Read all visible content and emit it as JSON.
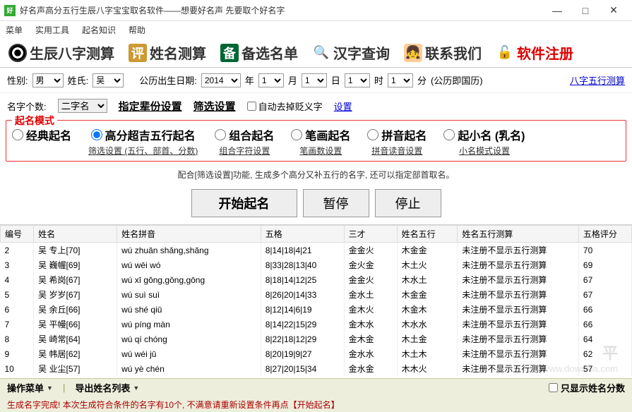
{
  "window": {
    "title": "好名声高分五行生辰八字宝宝取名软件——想要好名声 先要取个好名字",
    "minimize": "—",
    "maximize": "□",
    "close": "✕"
  },
  "menu": {
    "items": [
      "菜单",
      "实用工具",
      "起名知识",
      "帮助"
    ]
  },
  "tabs": [
    {
      "icon": "yinyang",
      "label": "生辰八字测算"
    },
    {
      "icon": "ping",
      "iconText": "评",
      "label": "姓名测算"
    },
    {
      "icon": "bei",
      "iconText": "备",
      "label": "备选名单"
    },
    {
      "icon": "mag",
      "iconText": "🔍",
      "label": "汉字查询"
    },
    {
      "icon": "face",
      "iconText": "👧",
      "label": "联系我们"
    },
    {
      "icon": "lock",
      "iconText": "🔓",
      "label": "软件注册",
      "red": true
    }
  ],
  "row1": {
    "gender_label": "性别:",
    "gender_value": "男",
    "surname_label": "姓氏:",
    "surname_value": "吴",
    "birth_label": "公历出生日期:",
    "year": "2014",
    "year_unit": "年",
    "month": "1",
    "month_unit": "月",
    "day": "1",
    "day_unit": "日",
    "hour": "1",
    "hour_unit": "时",
    "minute": "1",
    "minute_unit": "分",
    "calendar_note": "(公历即国历)",
    "link": "八字五行测算"
  },
  "row2": {
    "count_label": "名字个数:",
    "count_value": "二字名",
    "gen_link": "指定辈份设置",
    "filter_link": "筛选设置",
    "auto_cb": "自动去掉贬义字",
    "set_link": "设置"
  },
  "mode": {
    "title": "起名模式",
    "options": [
      {
        "label": "经典起名",
        "sub": ""
      },
      {
        "label": "高分超吉五行起名",
        "sub": "筛选设置 (五行、部首、分数)",
        "checked": true
      },
      {
        "label": "组合起名",
        "sub": "组合字符设置"
      },
      {
        "label": "笔画起名",
        "sub": "笔画数设置"
      },
      {
        "label": "拼音起名",
        "sub": "拼音读音设置"
      },
      {
        "label": "起小名 (乳名)",
        "sub": "小名模式设置"
      }
    ],
    "hint": "配合[筛选设置]功能, 生成多个高分又补五行的名字, 还可以指定部首取名。"
  },
  "actions": {
    "start": "开始起名",
    "pause": "暂停",
    "stop": "停止"
  },
  "table": {
    "headers": [
      "编号",
      "姓名",
      "姓名拼音",
      "五格",
      "三才",
      "姓名五行",
      "姓名五行测算",
      "五格评分"
    ],
    "rows": [
      [
        "2",
        "吴 专上[70]",
        "wú zhuān shǎng,shǎng",
        "8|14|18|4|21",
        "金金火",
        "木金金",
        "未注册不显示五行测算",
        "70"
      ],
      [
        "3",
        "吴 巍幄[69]",
        "wú wēi wó",
        "8|33|28|13|40",
        "金火金",
        "木土火",
        "未注册不显示五行测算",
        "69"
      ],
      [
        "4",
        "吴 希岗[67]",
        "wú xī gǒng,gǒng,gōng",
        "8|18|14|12|25",
        "金金火",
        "木水土",
        "未注册不显示五行测算",
        "67"
      ],
      [
        "5",
        "吴 岁岁[67]",
        "wú suì suì",
        "8|26|20|14|33",
        "金水土",
        "木金金",
        "未注册不显示五行测算",
        "67"
      ],
      [
        "6",
        "吴 余丘[66]",
        "wú shé qiū",
        "8|12|14|6|19",
        "金木火",
        "木金木",
        "未注册不显示五行测算",
        "66"
      ],
      [
        "7",
        "吴 平幔[66]",
        "wú píng màn",
        "8|14|22|15|29",
        "金木水",
        "木水水",
        "未注册不显示五行测算",
        "66"
      ],
      [
        "8",
        "吴 崎常[64]",
        "wú qí chóng",
        "8|22|18|12|29",
        "金木金",
        "木土金",
        "未注册不显示五行测算",
        "64"
      ],
      [
        "9",
        "吴 帏居[62]",
        "wú wéi jū",
        "8|20|19|9|27",
        "金水水",
        "木土木",
        "未注册不显示五行测算",
        "62"
      ],
      [
        "10",
        "吴 业尘[57]",
        "wú yè chén",
        "8|27|20|15|34",
        "金水金",
        "木木火",
        "未注册不显示五行测算",
        "57"
      ]
    ]
  },
  "footer": {
    "ops_menu": "操作菜单",
    "export": "导出姓名列表",
    "show_scores": "只显示姓名分数"
  },
  "status": "生成名字完成! 本次生成符合条件的名字有10个, 不满意请重新设置条件再点【开始起名】",
  "watermark": {
    "big": "平",
    "small": "www.downxia.com"
  }
}
